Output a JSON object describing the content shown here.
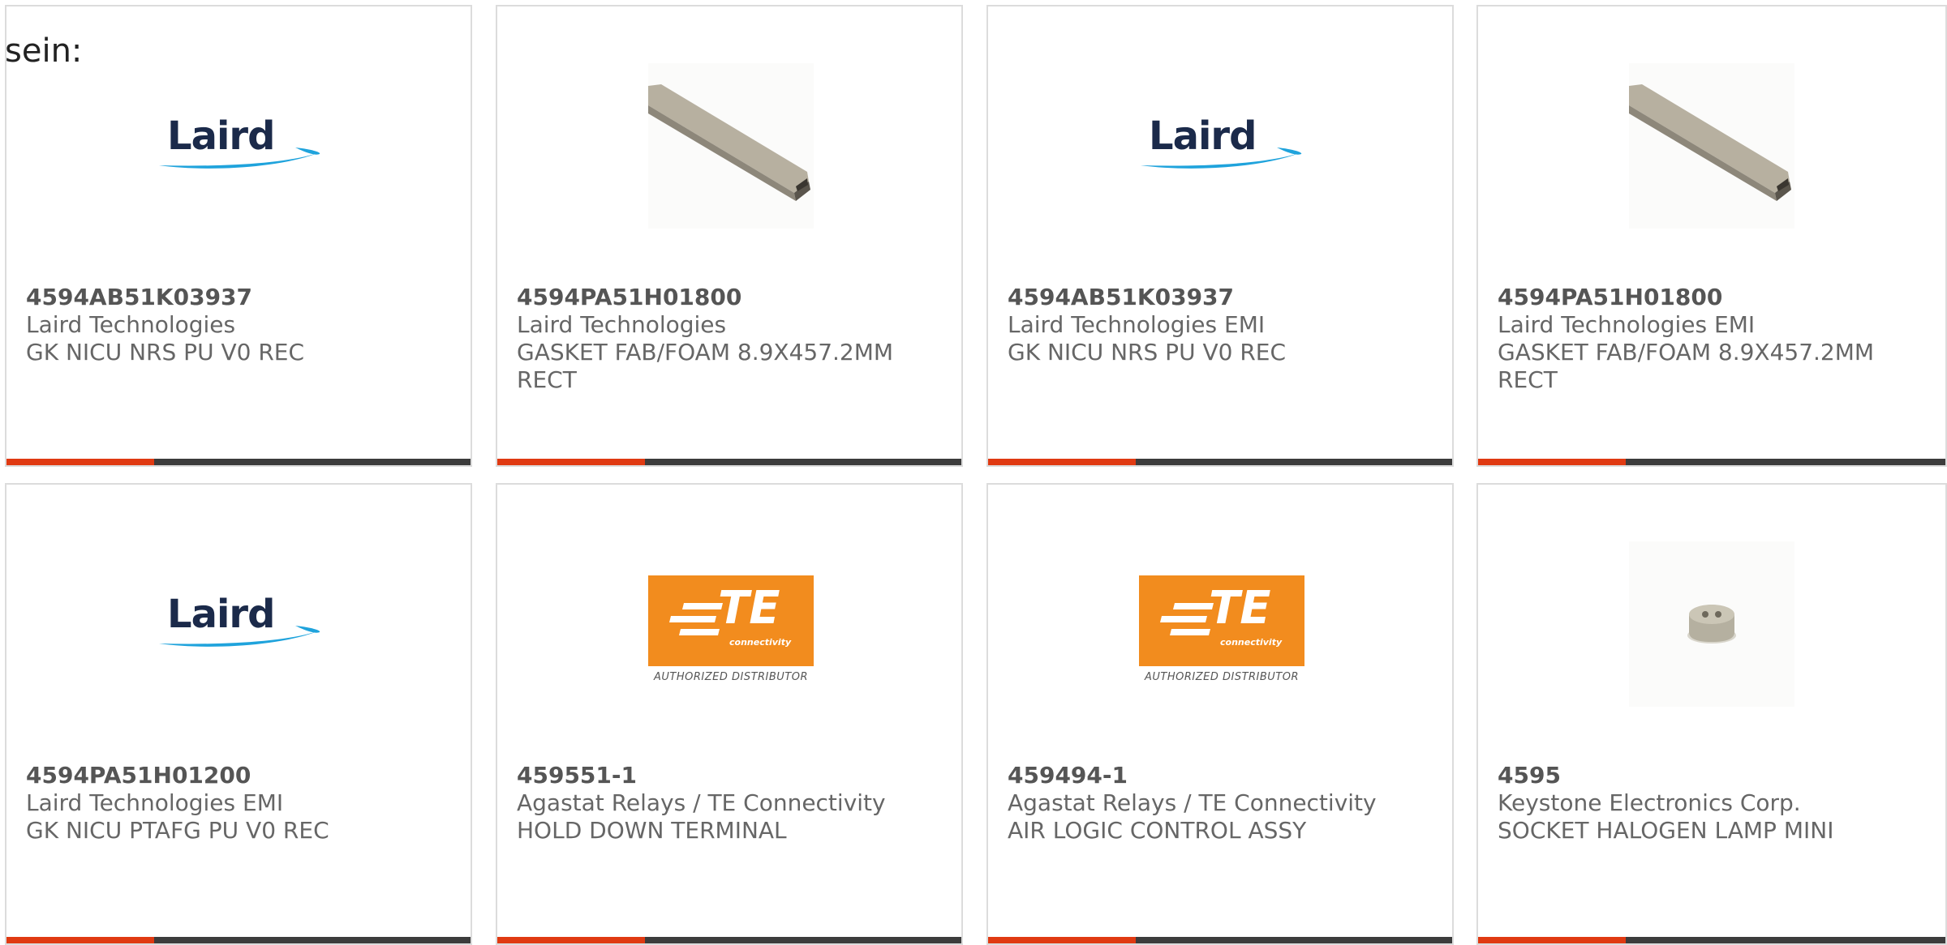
{
  "page": {
    "heading": "sein:"
  },
  "colors": {
    "accent": "#e03a12",
    "bar": "#3c3c3c",
    "card_border": "#dcdcdc",
    "text": "#666666",
    "te_orange": "#f28c1e",
    "laird_navy": "#1b2a4a",
    "laird_swoosh": "#1fa3dc"
  },
  "logos": {
    "laird": {
      "word": "Laird"
    },
    "te": {
      "mark": "TE",
      "sub": "connectivity",
      "authorized": "AUTHORIZED DISTRIBUTOR"
    }
  },
  "products": [
    {
      "part_number": "4594AB51K03937",
      "manufacturer": "Laird Technologies",
      "description": "GK NICU NRS PU V0 REC",
      "image": "laird-logo"
    },
    {
      "part_number": "4594PA51H01800",
      "manufacturer": "Laird Technologies",
      "description": "GASKET FAB/FOAM 8.9X457.2MM RECT",
      "image": "gasket-strip-photo"
    },
    {
      "part_number": "4594AB51K03937",
      "manufacturer": "Laird Technologies EMI",
      "description": "GK NICU NRS PU V0 REC",
      "image": "laird-logo"
    },
    {
      "part_number": "4594PA51H01800",
      "manufacturer": "Laird Technologies EMI",
      "description": "GASKET FAB/FOAM 8.9X457.2MM RECT",
      "image": "gasket-strip-photo"
    },
    {
      "part_number": "4594PA51H01200",
      "manufacturer": "Laird Technologies EMI",
      "description": "GK NICU PTAFG PU V0 REC",
      "image": "laird-logo"
    },
    {
      "part_number": "459551-1",
      "manufacturer": "Agastat Relays / TE Connectivity",
      "description": "HOLD DOWN TERMINAL",
      "image": "te-logo"
    },
    {
      "part_number": "459494-1",
      "manufacturer": "Agastat Relays / TE Connectivity",
      "description": "AIR LOGIC CONTROL ASSY",
      "image": "te-logo"
    },
    {
      "part_number": "4595",
      "manufacturer": "Keystone Electronics Corp.",
      "description": "SOCKET HALOGEN LAMP MINI",
      "image": "lamp-socket-photo"
    }
  ]
}
